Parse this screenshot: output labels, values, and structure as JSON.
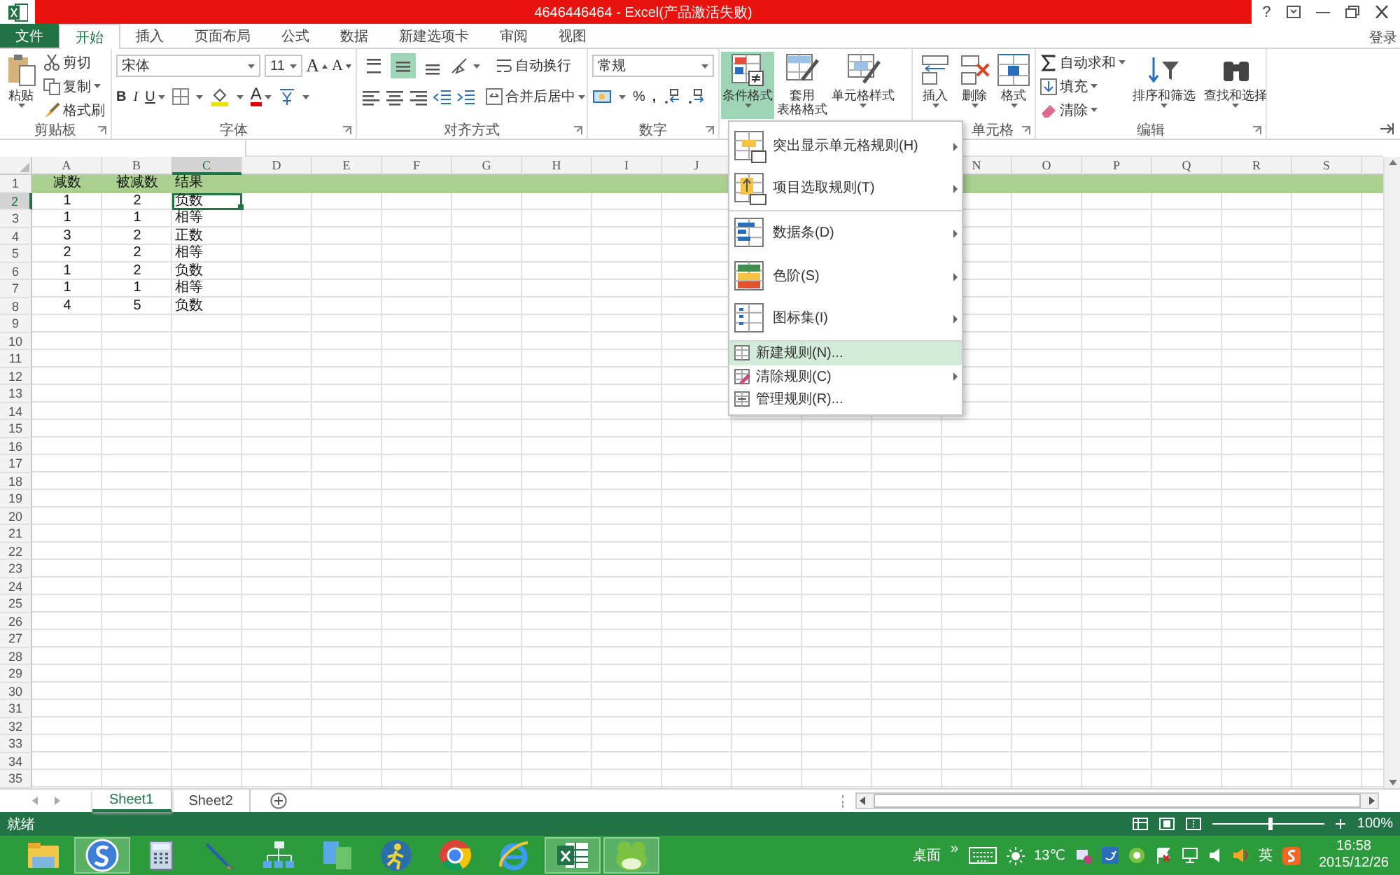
{
  "window": {
    "title": "4646446464 - Excel(产品激活失败)",
    "help": "?",
    "account": "登录"
  },
  "tabs": [
    {
      "label": "文件",
      "kind": "file",
      "selected": false
    },
    {
      "label": "开始",
      "kind": "tab",
      "selected": true
    },
    {
      "label": "插入",
      "kind": "tab",
      "selected": false
    },
    {
      "label": "页面布局",
      "kind": "tab",
      "selected": false
    },
    {
      "label": "公式",
      "kind": "tab",
      "selected": false
    },
    {
      "label": "数据",
      "kind": "tab",
      "selected": false
    },
    {
      "label": "新建选项卡",
      "kind": "tab",
      "selected": false
    },
    {
      "label": "审阅",
      "kind": "tab",
      "selected": false
    },
    {
      "label": "视图",
      "kind": "tab",
      "selected": false
    }
  ],
  "ribbon": {
    "clipboard": {
      "label": "剪贴板",
      "paste": "粘贴",
      "items": [
        "剪切",
        "复制",
        "格式刷"
      ]
    },
    "font": {
      "label": "字体",
      "name": "宋体",
      "size": "11",
      "grow": "A",
      "shrink": "A",
      "bold": "B",
      "italic": "I",
      "underline": "U",
      "font_color_label": "A"
    },
    "alignment": {
      "label": "对齐方式",
      "vertical": [
        {
          "selected": false
        },
        {
          "selected": true
        },
        {
          "selected": false
        }
      ],
      "wrap": "自动换行",
      "merge": "合并后居中"
    },
    "number": {
      "label": "数字",
      "format": "常规",
      "percent": "%",
      "comma": ","
    },
    "styles": {
      "buttons": [
        {
          "lines": [
            "条件格式"
          ],
          "selected": true
        },
        {
          "lines": [
            "套用",
            "表格格式"
          ],
          "selected": false
        },
        {
          "lines": [
            "单元格样式"
          ],
          "selected": false
        }
      ]
    },
    "cells": {
      "label": "单元格",
      "buttons": [
        "插入",
        "删除",
        "格式"
      ]
    },
    "editing": {
      "label": "编辑",
      "small": [
        "自动求和",
        "填充",
        "清除"
      ],
      "big": [
        "排序和筛选",
        "查找和选择"
      ]
    }
  },
  "sheet": {
    "columns": [
      {
        "label": "A",
        "selected": false
      },
      {
        "label": "B",
        "selected": false
      },
      {
        "label": "C",
        "selected": true
      },
      {
        "label": "D",
        "selected": false
      },
      {
        "label": "E",
        "selected": false
      },
      {
        "label": "F",
        "selected": false
      },
      {
        "label": "G",
        "selected": false
      },
      {
        "label": "H",
        "selected": false
      },
      {
        "label": "I",
        "selected": false
      },
      {
        "label": "J",
        "selected": false
      },
      null,
      null,
      null,
      {
        "label": "N",
        "selected": false
      },
      {
        "label": "O",
        "selected": false
      },
      {
        "label": "P",
        "selected": false
      },
      {
        "label": "Q",
        "selected": false
      },
      {
        "label": "R",
        "selected": false
      },
      {
        "label": "S",
        "selected": false
      }
    ],
    "rows": [
      {
        "label": "1",
        "selected": false,
        "highlighted": true,
        "cells": [
          {
            "v": "减数",
            "active": false
          },
          {
            "v": "被减数",
            "active": false
          },
          {
            "v": "结果",
            "active": false
          }
        ]
      },
      {
        "label": "2",
        "selected": true,
        "highlighted": false,
        "cells": [
          {
            "v": "1",
            "active": false
          },
          {
            "v": "2",
            "active": false
          },
          {
            "v": "负数",
            "active": true
          }
        ]
      },
      {
        "label": "3",
        "selected": false,
        "highlighted": false,
        "cells": [
          {
            "v": "1",
            "active": false
          },
          {
            "v": "1",
            "active": false
          },
          {
            "v": "相等",
            "active": false
          }
        ]
      },
      {
        "label": "4",
        "selected": false,
        "highlighted": false,
        "cells": [
          {
            "v": "3",
            "active": false
          },
          {
            "v": "2",
            "active": false
          },
          {
            "v": "正数",
            "active": false
          }
        ]
      },
      {
        "label": "5",
        "selected": false,
        "highlighted": false,
        "cells": [
          {
            "v": "2",
            "active": false
          },
          {
            "v": "2",
            "active": false
          },
          {
            "v": "相等",
            "active": false
          }
        ]
      },
      {
        "label": "6",
        "selected": false,
        "highlighted": false,
        "cells": [
          {
            "v": "1",
            "active": false
          },
          {
            "v": "2",
            "active": false
          },
          {
            "v": "负数",
            "active": false
          }
        ]
      },
      {
        "label": "7",
        "selected": false,
        "highlighted": false,
        "cells": [
          {
            "v": "1",
            "active": false
          },
          {
            "v": "1",
            "active": false
          },
          {
            "v": "相等",
            "active": false
          }
        ]
      },
      {
        "label": "8",
        "selected": false,
        "highlighted": false,
        "cells": [
          {
            "v": "4",
            "active": false
          },
          {
            "v": "5",
            "active": false
          },
          {
            "v": "负数",
            "active": false
          }
        ]
      },
      {
        "label": "9",
        "selected": false,
        "highlighted": false
      },
      {
        "label": "10",
        "selected": false,
        "highlighted": false
      },
      {
        "label": "11",
        "selected": false,
        "highlighted": false
      },
      {
        "label": "12",
        "selected": false,
        "highlighted": false
      },
      {
        "label": "13",
        "selected": false,
        "highlighted": false
      },
      {
        "label": "14",
        "selected": false,
        "highlighted": false
      },
      {
        "label": "15",
        "selected": false,
        "highlighted": false
      },
      {
        "label": "16",
        "selected": false,
        "highlighted": false
      },
      {
        "label": "17",
        "selected": false,
        "highlighted": false
      },
      {
        "label": "18",
        "selected": false,
        "highlighted": false
      },
      {
        "label": "19",
        "selected": false,
        "highlighted": false
      },
      {
        "label": "20",
        "selected": false,
        "highlighted": false
      },
      {
        "label": "21",
        "selected": false,
        "highlighted": false
      },
      {
        "label": "22",
        "selected": false,
        "highlighted": false
      },
      {
        "label": "23",
        "selected": false,
        "highlighted": false
      },
      {
        "label": "24",
        "selected": false,
        "highlighted": false
      },
      {
        "label": "25",
        "selected": false,
        "highlighted": false
      },
      {
        "label": "26",
        "selected": false,
        "highlighted": false
      },
      {
        "label": "27",
        "selected": false,
        "highlighted": false
      },
      {
        "label": "28",
        "selected": false,
        "highlighted": false
      },
      {
        "label": "29",
        "selected": false,
        "highlighted": false
      },
      {
        "label": "30",
        "selected": false,
        "highlighted": false
      },
      {
        "label": "31",
        "selected": false,
        "highlighted": false
      },
      {
        "label": "32",
        "selected": false,
        "highlighted": false
      },
      {
        "label": "33",
        "selected": false,
        "highlighted": false
      },
      {
        "label": "34",
        "selected": false,
        "highlighted": false
      },
      {
        "label": "35",
        "selected": false,
        "highlighted": false
      }
    ]
  },
  "menu": [
    {
      "label": "突出显示单元格规则(H)",
      "kind": "big",
      "submenu": true,
      "highlighted": false,
      "separator_after": false
    },
    {
      "label": "项目选取规则(T)",
      "kind": "big",
      "submenu": true,
      "highlighted": false,
      "separator_after": true
    },
    {
      "label": "数据条(D)",
      "kind": "big",
      "submenu": true,
      "highlighted": false,
      "separator_after": false
    },
    {
      "label": "色阶(S)",
      "kind": "big",
      "submenu": true,
      "highlighted": false,
      "separator_after": false
    },
    {
      "label": "图标集(I)",
      "kind": "big",
      "submenu": true,
      "highlighted": false,
      "separator_after": true
    },
    {
      "label": "新建规则(N)...",
      "kind": "small",
      "submenu": false,
      "highlighted": true,
      "separator_after": false
    },
    {
      "label": "清除规则(C)",
      "kind": "small",
      "submenu": true,
      "highlighted": false,
      "separator_after": false
    },
    {
      "label": "管理规则(R)...",
      "kind": "small",
      "submenu": false,
      "highlighted": false,
      "separator_after": false
    }
  ],
  "sheet_tabs": [
    {
      "label": "Sheet1",
      "selected": true
    },
    {
      "label": "Sheet2",
      "selected": false
    }
  ],
  "status_bar": {
    "text": "就绪",
    "zoom": {
      "label": "100%",
      "level": 0.5
    }
  },
  "taskbar": {
    "apps": [
      {
        "selected": false
      },
      {
        "selected": true
      },
      {
        "selected": false
      },
      {
        "selected": false
      },
      {
        "selected": false
      },
      {
        "selected": false
      },
      {
        "selected": false
      },
      {
        "selected": false
      },
      {
        "selected": false
      },
      {
        "selected": true
      },
      {
        "selected": true
      }
    ],
    "desktop": "桌面",
    "more": "»",
    "temperature": "13℃",
    "ime": "英",
    "time": "16:58",
    "date": "2015/12/26"
  }
}
